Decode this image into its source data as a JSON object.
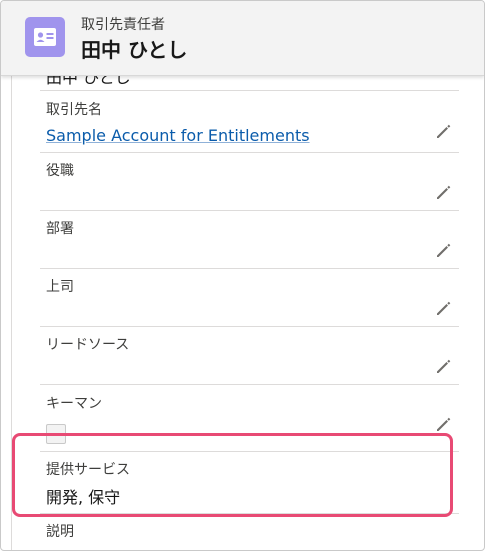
{
  "header": {
    "object_type": "取引先責任者",
    "record_name": "田中 ひとし"
  },
  "scrolled_partial_value": "田中 ひとし",
  "fields": [
    {
      "label": "取引先名",
      "value": "Sample Account for Entitlements",
      "is_link": true
    },
    {
      "label": "役職",
      "value": ""
    },
    {
      "label": "部署",
      "value": ""
    },
    {
      "label": "上司",
      "value": ""
    },
    {
      "label": "リードソース",
      "value": ""
    },
    {
      "label": "キーマン",
      "checked": false
    },
    {
      "label": "提供サービス",
      "value": "開発, 保守"
    },
    {
      "label": "説明",
      "value": ""
    }
  ],
  "colors": {
    "icon_bg": "#a094ed",
    "link": "#0b5cab",
    "highlight": "#e84a74"
  },
  "icons": [
    "contact-card-icon",
    "pencil-edit-icon"
  ]
}
